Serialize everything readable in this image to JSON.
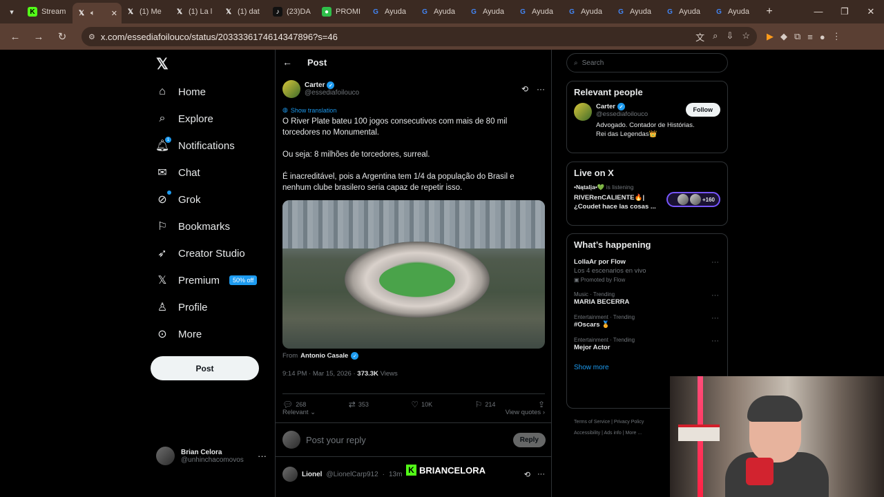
{
  "browser": {
    "tabs": [
      {
        "title": "Stream",
        "icon": "kick-icon",
        "active": false
      },
      {
        "title": "",
        "icon": "x-icon",
        "active": true
      },
      {
        "title": "(1) Me",
        "icon": "x-icon",
        "active": false
      },
      {
        "title": "(1) La l",
        "icon": "x-icon",
        "active": false
      },
      {
        "title": "(1) dat",
        "icon": "x-icon",
        "active": false
      },
      {
        "title": "(23)DA",
        "icon": "tiktok-icon",
        "active": false
      },
      {
        "title": "PROMI",
        "icon": "promo-icon",
        "active": false
      },
      {
        "title": "Ayuda",
        "icon": "google-icon",
        "active": false
      },
      {
        "title": "Ayuda",
        "icon": "google-icon",
        "active": false
      },
      {
        "title": "Ayuda",
        "icon": "google-icon",
        "active": false
      },
      {
        "title": "Ayuda",
        "icon": "google-icon",
        "active": false
      },
      {
        "title": "Ayuda",
        "icon": "google-icon",
        "active": false
      },
      {
        "title": "Ayuda",
        "icon": "google-icon",
        "active": false
      },
      {
        "title": "Ayuda",
        "icon": "google-icon",
        "active": false
      },
      {
        "title": "Ayuda",
        "icon": "google-icon",
        "active": false
      }
    ],
    "url": "x.com/essediafoilouco/status/2033336174614347896?s=46"
  },
  "nav": {
    "items": [
      {
        "label": "Home",
        "icon": "home-icon"
      },
      {
        "label": "Explore",
        "icon": "search-icon"
      },
      {
        "label": "Notifications",
        "icon": "bell-icon"
      },
      {
        "label": "Chat",
        "icon": "mail-icon"
      },
      {
        "label": "Grok",
        "icon": "grok-icon"
      },
      {
        "label": "Bookmarks",
        "icon": "bookmark-icon"
      },
      {
        "label": "Creator Studio",
        "icon": "rocket-icon"
      },
      {
        "label": "Premium",
        "icon": "x-icon"
      },
      {
        "label": "Profile",
        "icon": "person-icon"
      },
      {
        "label": "More",
        "icon": "more-circle-icon"
      }
    ],
    "premium_badge": "50% off",
    "notification_count": "1",
    "post_button": "Post",
    "me": {
      "name": "Brian Celora",
      "handle": "@unhinchacomovos"
    }
  },
  "post": {
    "header": "Post",
    "author": {
      "name": "Carter",
      "handle": "@essediafoilouco"
    },
    "show_translation": "Show translation",
    "paragraphs": [
      "O River Plate bateu 100 jogos consecutivos com mais de 80 mil torcedores no Monumental.",
      "Ou seja: 8 milhões de torcedores, surreal.",
      "É inacreditável, pois a Argentina tem 1/4 da população do Brasil e nenhum clube brasilero seria capaz de repetir isso."
    ],
    "from_label": "From",
    "from_name": "Antonio Casale",
    "time": "9:14 PM",
    "date": "Mar 15, 2026",
    "views_count": "373.3K",
    "views_label": "Views",
    "stats": {
      "replies": "268",
      "reposts": "353",
      "likes": "10K",
      "bookmarks": "214"
    },
    "sort_label": "Relevant",
    "view_quotes": "View quotes",
    "reply_placeholder": "Post your reply",
    "reply_button": "Reply",
    "next_reply": {
      "name": "Lionel",
      "handle": "@LionelCarp912",
      "time": "13m"
    }
  },
  "right": {
    "search_placeholder": "Search",
    "relevant_people": {
      "title": "Relevant people",
      "name": "Carter",
      "handle": "@essediafoilouco",
      "bio": "Advogado. Contador de Histórias. Rei das Legendas👑",
      "follow": "Follow"
    },
    "live": {
      "title": "Live on X",
      "user": "•Nątalįa•💚",
      "status": "is listening",
      "text": "RIVERenCALIENTE🔥| ¿Coudet hace las cosas ...",
      "count": "+160"
    },
    "happening": {
      "title": "What’s happening",
      "trends": [
        {
          "category": "",
          "title": "LollaAr por Flow",
          "sub": "Los 4 escenarios en vivo",
          "promo": "Promoted by Flow"
        },
        {
          "category": "Music · Trending",
          "title": "MARIA BECERRA",
          "sub": "",
          "promo": ""
        },
        {
          "category": "Entertainment · Trending",
          "title": "#Oscars 🏅",
          "sub": "",
          "promo": ""
        },
        {
          "category": "Entertainment · Trending",
          "title": "Mejor Actor",
          "sub": "",
          "promo": ""
        }
      ],
      "show_more": "Show more"
    },
    "footer": {
      "links": [
        "Terms of Service",
        "Privacy Policy",
        "Accessibility",
        "Ads info",
        "More ..."
      ]
    }
  },
  "overlay": {
    "brand": "BRIANCELORA",
    "brand_letter": "K"
  }
}
